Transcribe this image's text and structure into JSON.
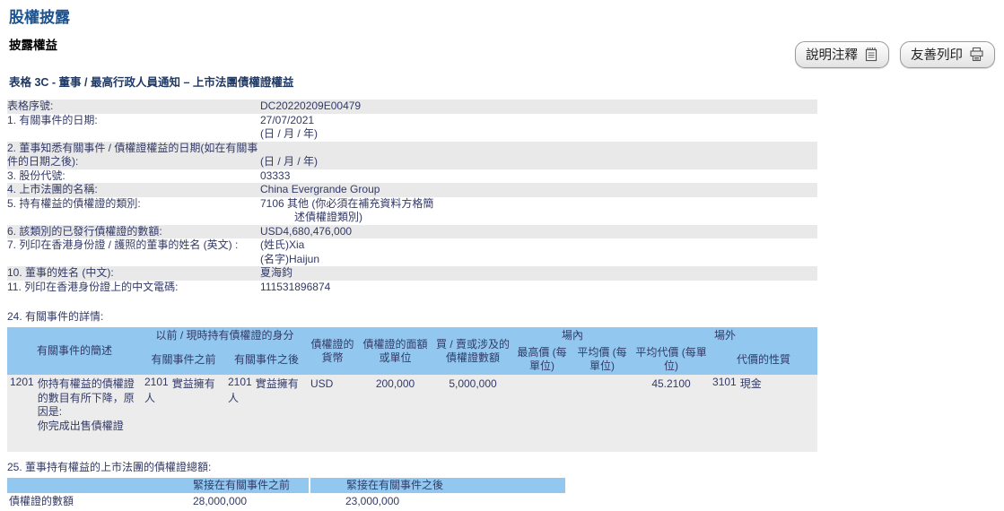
{
  "page": {
    "title": "股權披露",
    "subtitle": "披露權益",
    "form_title": "表格 3C - 董事 / 最高行政人員通知 – 上市法團債權證權益"
  },
  "toolbar": {
    "notes_label": "說明注釋",
    "print_label": "友善列印",
    "icons": [
      "memo-icon",
      "printer-icon"
    ]
  },
  "colors": {
    "title_blue": "#1c5390",
    "text_navy": "#333a66",
    "header_blue": "#92c8f0",
    "row_gray": "#e9e9e9",
    "data_row_gray": "#ececec"
  },
  "fields": [
    {
      "label": "表格序號:",
      "values": [
        "DC20220209E00479"
      ]
    },
    {
      "label": "1. 有關事件的日期:",
      "values": [
        "27/07/2021",
        "(日 / 月 / 年)"
      ]
    },
    {
      "label": "2. 董事知悉有關事件 / 債權證權益的日期(如在有關事件的日期之後):",
      "values": [
        "",
        "(日 / 月 / 年)"
      ]
    },
    {
      "label": "3. 股份代號:",
      "values": [
        "03333"
      ]
    },
    {
      "label": "4. 上市法團的名稱:",
      "values": [
        "China Evergrande Group"
      ]
    },
    {
      "label": "5. 持有權益的債權證的類別:",
      "values": [
        "7106 其他  (你必須在補充資料方格簡",
        "述債權證類別)"
      ]
    },
    {
      "label": "6. 該類別的已發行債權證的數額:",
      "values": [
        "USD4,680,476,000"
      ]
    },
    {
      "label": "7. 列印在香港身份證 / 護照的董事的姓名 (英文) :",
      "values": [
        "(姓氏)Xia",
        "(名字)Haijun"
      ]
    },
    {
      "label": "10. 董事的姓名 (中文):",
      "values": [
        "夏海鈞"
      ]
    },
    {
      "label": "11. 列印在香港身份證上的中文電碼:",
      "values": [
        "111531896874"
      ]
    }
  ],
  "details": {
    "section_title": "24. 有關事件的詳情:",
    "header": {
      "desc": "有關事件的簡述",
      "capacity_group": "以前 / 現時持有債權證的身分",
      "before": "有關事件之前",
      "after": "有關事件之後",
      "currency": "債權證的貨幣",
      "denomination": "債權證的面額或單位",
      "amount": "買 / 賣或涉及的債權證數額",
      "on_exchange_group": "場內",
      "highest_price": "最高價 (每單位)",
      "avg_price": "平均價 (每單位)",
      "off_exchange_group": "場外",
      "avg_consideration": "平均代價 (每單位)",
      "nature": "代價的性質"
    },
    "row": {
      "desc_code": "1201",
      "desc_lines": [
        "你持有權益的債權證的數目有所下降，原因是:",
        "你完成出售債權證"
      ],
      "before_code": "2101",
      "before": "實益擁有人",
      "after_code": "2101",
      "after": "實益擁有人",
      "currency": "USD",
      "denomination": "200,000",
      "amount": "5,000,000",
      "highest_price": "",
      "avg_price": "",
      "avg_consideration": "45.2100",
      "nature_code": "3101",
      "nature": "現金"
    }
  },
  "totals": {
    "section_title": "25. 董事持有權益的上市法團的債權證總額:",
    "header_before": "緊接在有關事件之前",
    "header_after": "緊接在有關事件之後",
    "row_label": "債權證的數額",
    "before_value": "28,000,000",
    "after_value": "23,000,000"
  }
}
